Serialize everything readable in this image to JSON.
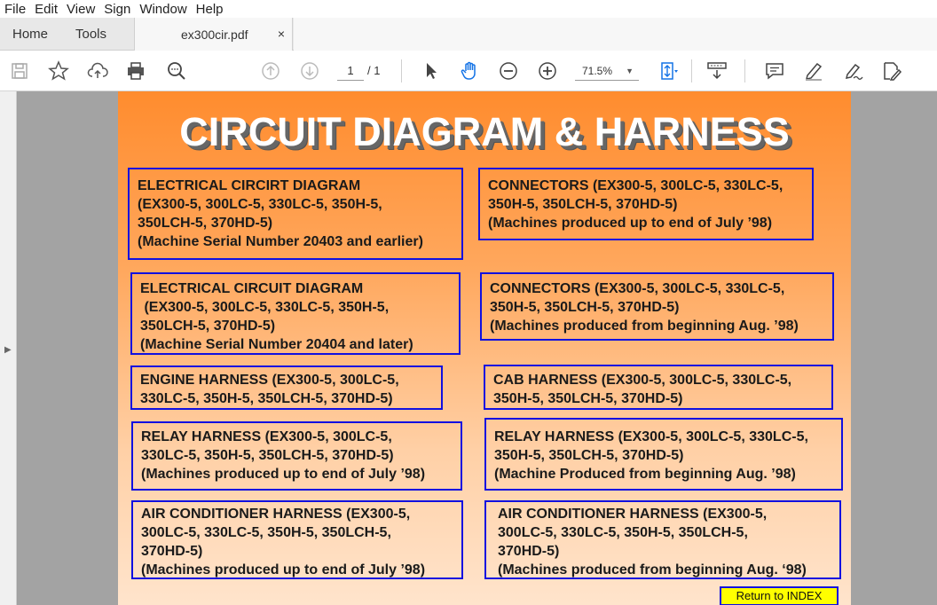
{
  "menu": [
    "File",
    "Edit",
    "View",
    "Sign",
    "Window",
    "Help"
  ],
  "tabs": {
    "home": "Home",
    "tools": "Tools",
    "document": "ex300cir.pdf",
    "close": "×"
  },
  "toolbar": {
    "page_current": "1",
    "page_total": "/  1",
    "zoom": "71.5%"
  },
  "document": {
    "title": "CIRCUIT DIAGRAM & HARNESS",
    "boxes": [
      {
        "text": "ELECTRICAL CIRCIRT DIAGRAM\n(EX300-5, 300LC-5, 330LC-5, 350H-5,\n350LCH-5, 370HD-5)\n(Machine Serial Number 20403 and earlier)"
      },
      {
        "text": "CONNECTORS (EX300-5, 300LC-5, 330LC-5,\n350H-5, 350LCH-5, 370HD-5)\n(Machines produced up to end of July ’98)"
      },
      {
        "text": "ELECTRICAL CIRCUIT DIAGRAM\n (EX300-5, 300LC-5, 330LC-5, 350H-5,\n350LCH-5, 370HD-5)\n(Machine Serial Number 20404 and later)"
      },
      {
        "text": "CONNECTORS (EX300-5, 300LC-5, 330LC-5,\n350H-5, 350LCH-5, 370HD-5)\n(Machines produced from beginning Aug. ’98)"
      },
      {
        "text": "ENGINE HARNESS (EX300-5, 300LC-5,\n330LC-5, 350H-5, 350LCH-5, 370HD-5)"
      },
      {
        "text": "CAB HARNESS (EX300-5, 300LC-5, 330LC-5,\n350H-5, 350LCH-5, 370HD-5)"
      },
      {
        "text": "RELAY HARNESS (EX300-5, 300LC-5,\n330LC-5, 350H-5, 350LCH-5, 370HD-5)\n(Machines produced up to end of July ’98)"
      },
      {
        "text": "RELAY HARNESS (EX300-5, 300LC-5, 330LC-5,\n350H-5, 350LCH-5, 370HD-5)\n(Machine Produced from beginning Aug. ’98)"
      },
      {
        "text": "AIR CONDITIONER HARNESS (EX300-5,\n300LC-5, 330LC-5, 350H-5, 350LCH-5,\n370HD-5)\n(Machines produced up to end of July ’98)"
      },
      {
        "text": "AIR CONDITIONER HARNESS (EX300-5,\n300LC-5, 330LC-5, 350H-5, 350LCH-5,\n370HD-5)\n(Machines produced from beginning Aug. ‘98)"
      }
    ],
    "return_link": "Return to INDEX"
  },
  "icons": [
    "save-icon",
    "star-icon",
    "upload-icon",
    "print-icon",
    "find-icon",
    "page-up-icon",
    "page-down-icon",
    "select-arrow-icon",
    "hand-icon",
    "zoom-out-icon",
    "zoom-in-icon",
    "fit-page-icon",
    "scroll-mode-icon",
    "comment-icon",
    "highlight-icon",
    "sign-icon",
    "edit-pdf-icon"
  ],
  "colors": {
    "box_border": "#1010e0",
    "page_top": "#ff8c2e",
    "page_bottom": "#ffe4cc",
    "return_bg": "#ffff00"
  }
}
